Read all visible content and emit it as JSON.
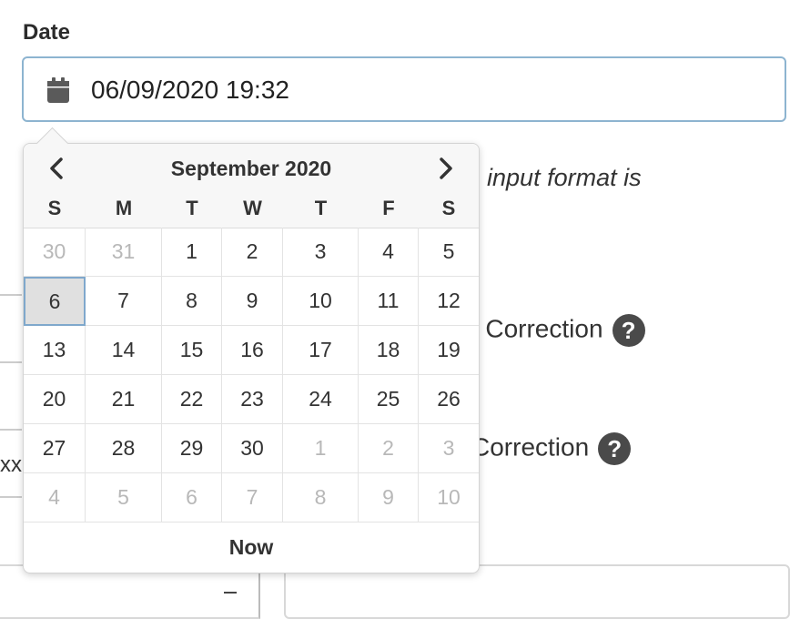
{
  "field": {
    "label": "Date",
    "value": "06/09/2020 19:32"
  },
  "background": {
    "help_text": "te input format is",
    "label_1": "e Correction",
    "label_2": "Correction",
    "help_icon": "?",
    "truncated": "xx"
  },
  "picker": {
    "title": "September 2020",
    "prev_icon": "chevron-left",
    "next_icon": "chevron-right",
    "weekdays": [
      "S",
      "M",
      "T",
      "W",
      "T",
      "F",
      "S"
    ],
    "weeks": [
      [
        "30",
        "31",
        "1",
        "2",
        "3",
        "4",
        "5"
      ],
      [
        "6",
        "7",
        "8",
        "9",
        "10",
        "11",
        "12"
      ],
      [
        "13",
        "14",
        "15",
        "16",
        "17",
        "18",
        "19"
      ],
      [
        "20",
        "21",
        "22",
        "23",
        "24",
        "25",
        "26"
      ],
      [
        "27",
        "28",
        "29",
        "30",
        "1",
        "2",
        "3"
      ],
      [
        "4",
        "5",
        "6",
        "7",
        "8",
        "9",
        "10"
      ]
    ],
    "selected_day": "6",
    "now_label": "Now"
  },
  "colors": {
    "input_border": "#8db4d0",
    "selected_bg": "#e0e0e0",
    "muted_text": "#b8b8b8"
  }
}
